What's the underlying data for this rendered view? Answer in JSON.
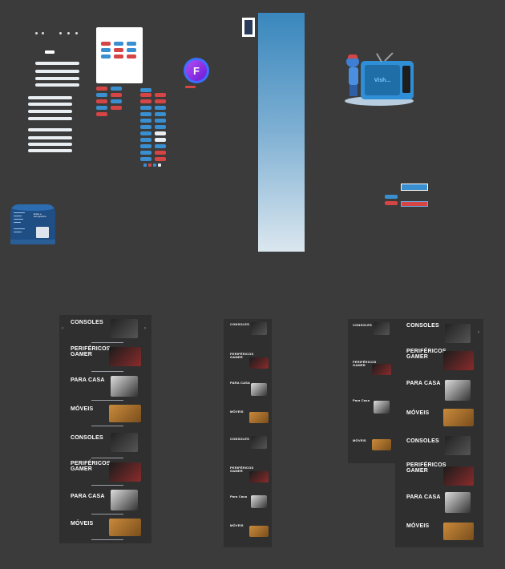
{
  "colors": {
    "canvas": "#3b3b3b",
    "board": "#2f2f2f",
    "accent_blue": "#3a8fd0",
    "accent_red": "#d64545",
    "avatar_purple": "#8b2be2",
    "avatar_ring": "#3b6fff",
    "tv_blue": "#2f8fd6"
  },
  "avatar": {
    "letter": "F"
  },
  "tv_illustration": {
    "screen_text": "Vish..."
  },
  "footer_card": {
    "heading": "Entre e acompanhe",
    "icon": "layers-icon"
  },
  "categories_a": [
    {
      "title": "CONSOLES",
      "image": "console-image"
    },
    {
      "title": "PERIFÉRICOS GAMER",
      "image": "keyboard-image"
    },
    {
      "title": "PARA CASA",
      "image": "appliance-image"
    },
    {
      "title": "MÓVEIS",
      "image": "furniture-image"
    },
    {
      "title": "CONSOLES",
      "image": "console-image"
    },
    {
      "title": "PERIFÉRICOS GAMER",
      "image": "keyboard-image"
    },
    {
      "title": "PARA CASA",
      "image": "appliance-image"
    },
    {
      "title": "MÓVEIS",
      "image": "furniture-image"
    }
  ],
  "categories_b": [
    {
      "title": "CONSOLES"
    },
    {
      "title": "PERIFÉRICOS GAMER"
    },
    {
      "title": "PARA CASA"
    },
    {
      "title": "MÓVEIS"
    },
    {
      "title": "CONSOLES"
    },
    {
      "title": "PERIFÉRICOS GAMER"
    },
    {
      "title": "Para Casa"
    },
    {
      "title": "MÓVEIS"
    }
  ],
  "categories_c": [
    {
      "title": "CONSOLES"
    },
    {
      "title": "PERIFÉRICOS GAMER"
    },
    {
      "title": "Para Casa"
    },
    {
      "title": "MÓVEIS"
    }
  ],
  "categories_d": [
    {
      "title": "CONSOLES"
    },
    {
      "title": "PERIFÉRICOS GAMER"
    },
    {
      "title": "PARA CASA"
    },
    {
      "title": "MÓVEIS"
    },
    {
      "title": "CONSOLES"
    },
    {
      "title": "PERIFÉRICOS GAMER"
    },
    {
      "title": "PARA CASA"
    },
    {
      "title": "MÓVEIS"
    }
  ],
  "arrows": {
    "left": "‹",
    "right": "›"
  }
}
